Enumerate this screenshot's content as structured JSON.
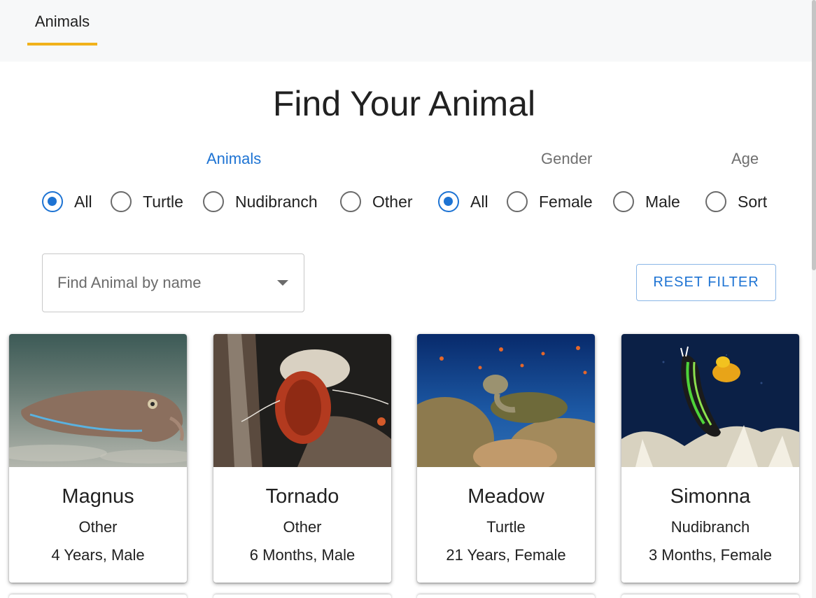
{
  "nav": {
    "tab_label": "Animals",
    "accent_color": "#f1b21b"
  },
  "page_title": "Find Your Animal",
  "filters": {
    "animals": {
      "label": "Animals",
      "options": [
        {
          "label": "All",
          "checked": true
        },
        {
          "label": "Turtle",
          "checked": false
        },
        {
          "label": "Nudibranch",
          "checked": false
        },
        {
          "label": "Other",
          "checked": false
        }
      ]
    },
    "gender": {
      "label": "Gender",
      "options": [
        {
          "label": "All",
          "checked": true
        },
        {
          "label": "Female",
          "checked": false
        },
        {
          "label": "Male",
          "checked": false
        }
      ]
    },
    "age": {
      "label": "Age",
      "options": [
        {
          "label": "Sort",
          "checked": false
        }
      ]
    }
  },
  "search": {
    "placeholder": "Find Animal by name"
  },
  "reset_button": {
    "label": "RESET FILTER"
  },
  "cards": [
    {
      "name": "Magnus",
      "type": "Other",
      "meta": "4 Years, Male",
      "image": "cuttlefish-photo"
    },
    {
      "name": "Tornado",
      "type": "Other",
      "meta": "6 Months, Male",
      "image": "hermit-crab-photo"
    },
    {
      "name": "Meadow",
      "type": "Turtle",
      "meta": "21 Years, Female",
      "image": "sea-turtle-photo"
    },
    {
      "name": "Simonna",
      "type": "Nudibranch",
      "meta": "3 Months, Female",
      "image": "nudibranch-photo"
    }
  ],
  "colors": {
    "primary": "#1d73d3",
    "muted": "#6f6f6f"
  }
}
